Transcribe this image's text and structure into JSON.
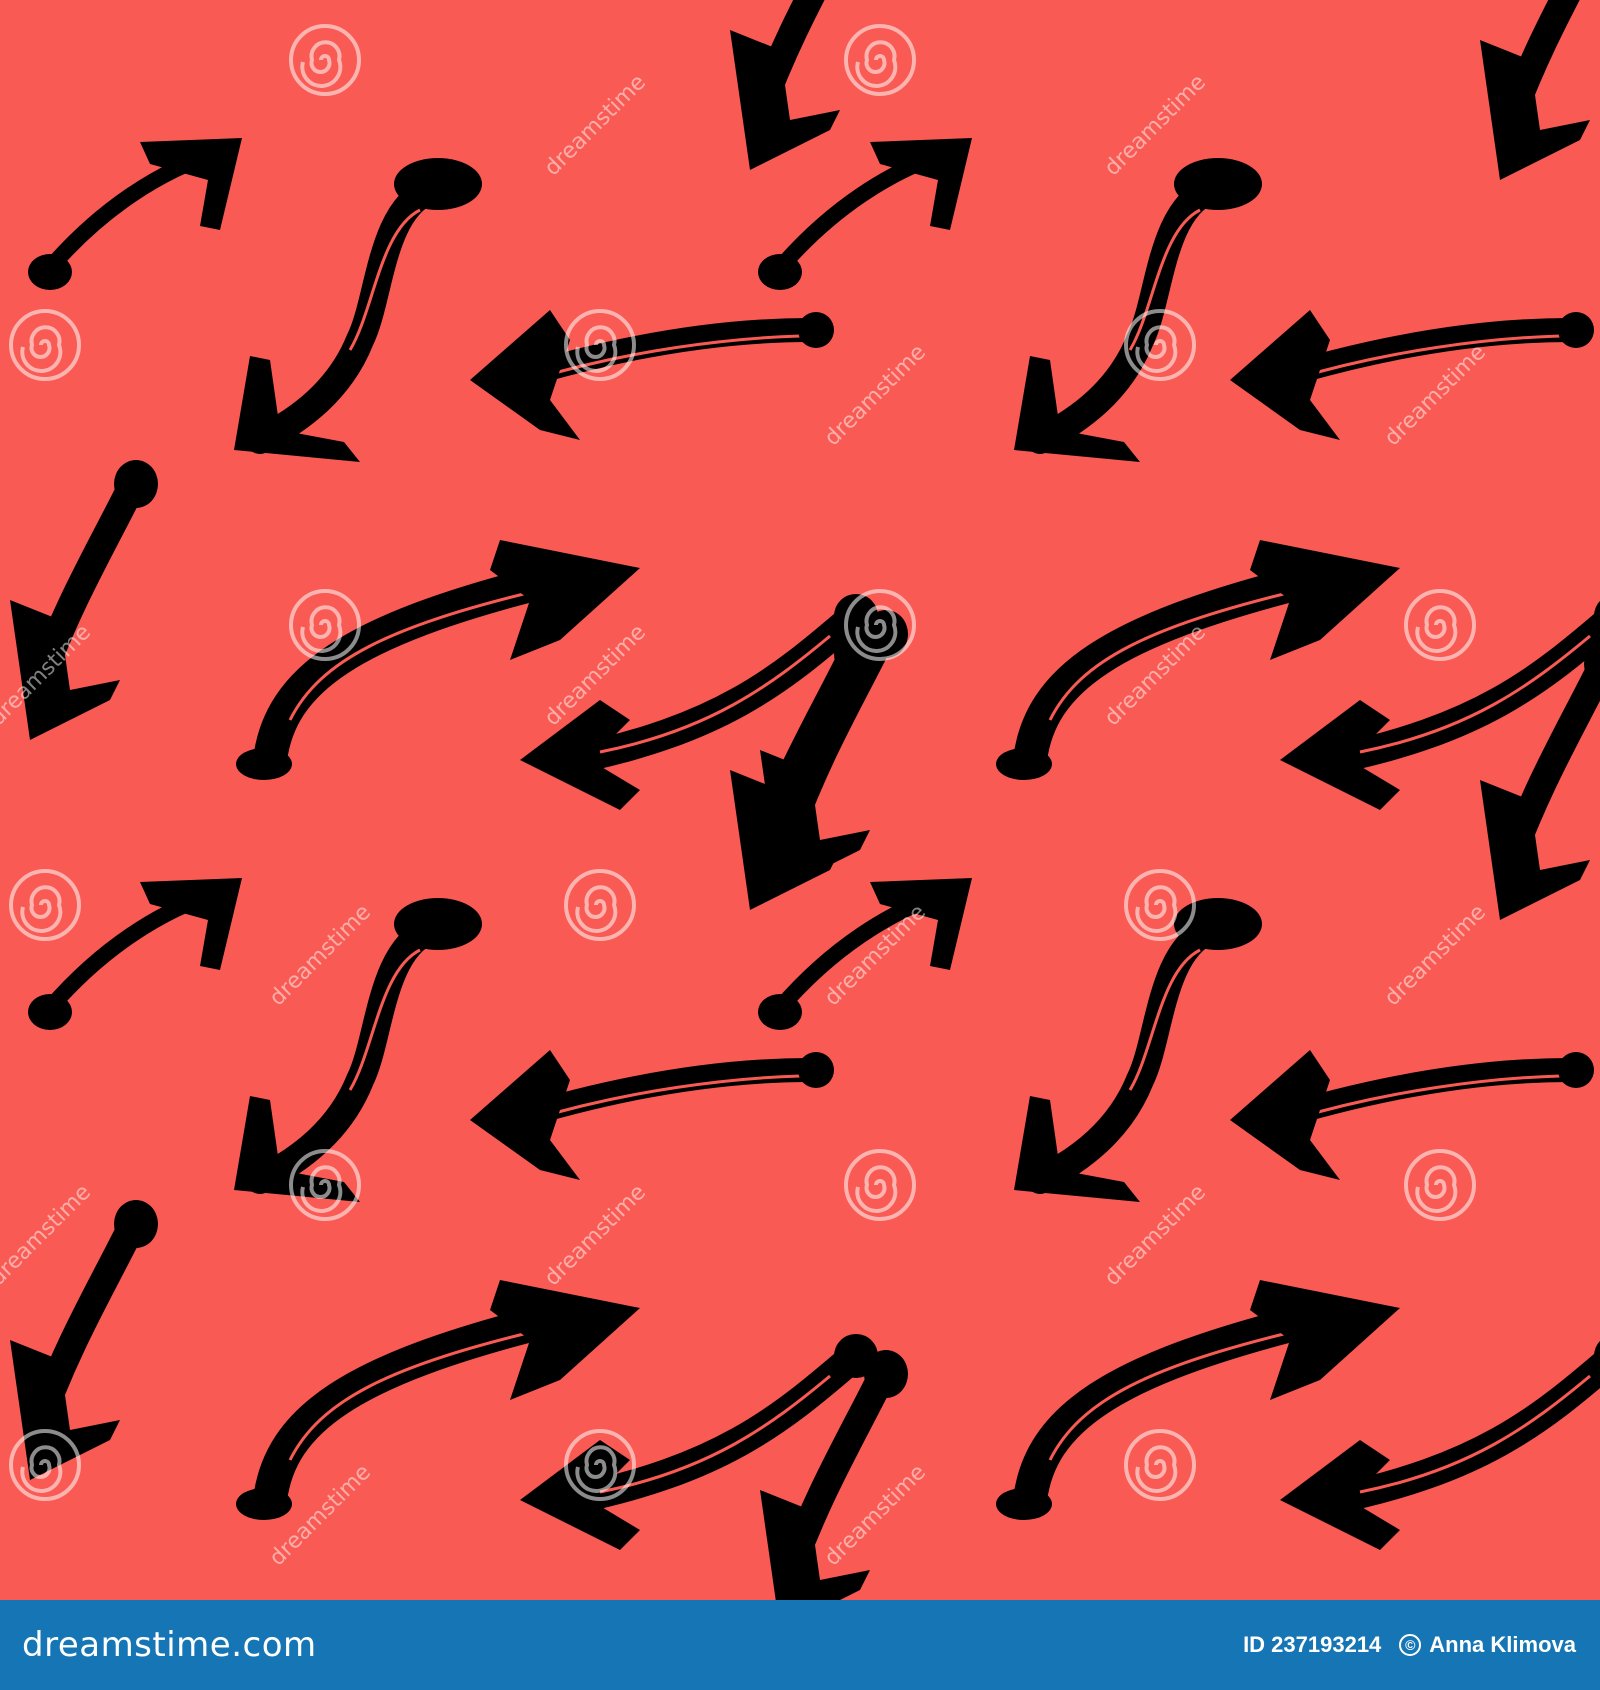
{
  "image": {
    "background_color": "#F95A53",
    "brush_color": "#000000",
    "watermark_color": "#FFFFFF",
    "footer_color": "#1676B5",
    "motif": "brush-arrow-seamless-pattern"
  },
  "watermark": {
    "text": "dreamstime",
    "logo_icon": "spiral-icon"
  },
  "footer": {
    "logo_text": "dreamstime.com",
    "id_label": "ID 237193214",
    "copyright_icon": "©",
    "author": "Anna Klimova"
  }
}
